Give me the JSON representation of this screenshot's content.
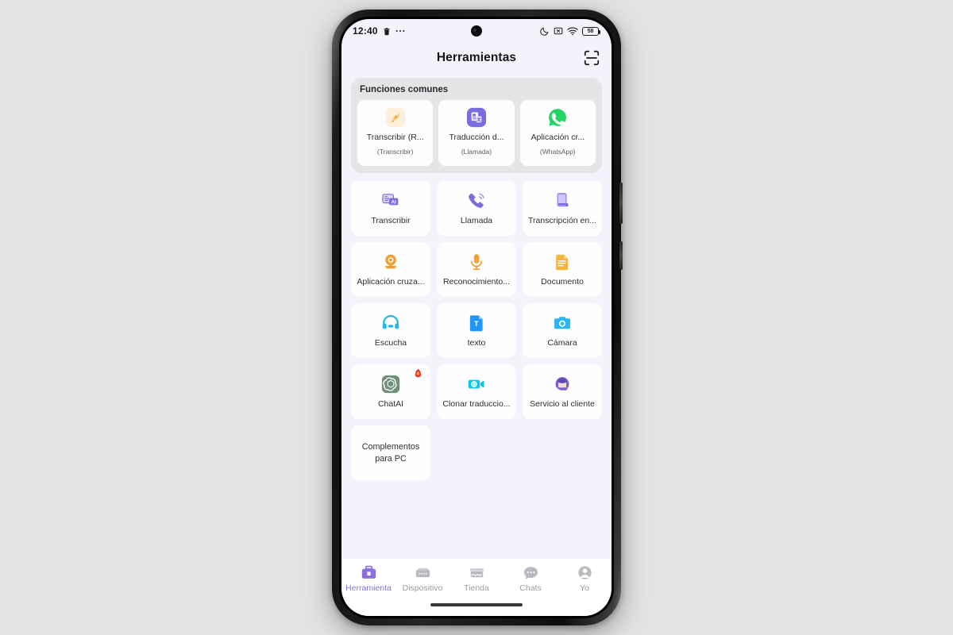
{
  "status_bar": {
    "time": "12:40",
    "left_icons": [
      "trash-icon",
      "more-dots-icon"
    ],
    "right_icons": [
      "moon-icon",
      "mute-icon",
      "wifi-icon"
    ],
    "battery_level": "58"
  },
  "header": {
    "title": "Herramientas",
    "scan_icon": "scan-icon"
  },
  "common_section": {
    "title": "Funciones comunes",
    "cards": [
      {
        "label": "Transcribir (R...",
        "sub": "(Transcribir)",
        "icon": "rocket-icon",
        "color": "#f5a623"
      },
      {
        "label": "Traducción d...",
        "sub": "(Llamada)",
        "icon": "translate-doc-icon",
        "color": "#7b6ce0"
      },
      {
        "label": "Aplicación cr...",
        "sub": "(WhatsApp)",
        "icon": "whatsapp-icon",
        "color": "#25d366"
      }
    ]
  },
  "tools": [
    {
      "label": "Transcribir",
      "icon": "ai-transcribe-icon",
      "color": "#7b6ce0",
      "badge": false
    },
    {
      "label": "Llamada",
      "icon": "phone-call-icon",
      "color": "#7b6ce0",
      "badge": false
    },
    {
      "label": "Transcripción en...",
      "icon": "phone-device-icon",
      "color": "#8d7ce8",
      "badge": false
    },
    {
      "label": "Aplicación cruza...",
      "icon": "webcam-icon",
      "color": "#f0a030",
      "badge": false
    },
    {
      "label": "Reconocimiento...",
      "icon": "microphone-icon",
      "color": "#f0a030",
      "badge": false
    },
    {
      "label": "Documento",
      "icon": "document-icon",
      "color": "#f5b43c",
      "badge": false
    },
    {
      "label": "Escucha",
      "icon": "headphones-icon",
      "color": "#22b8e0",
      "badge": false
    },
    {
      "label": "texto",
      "icon": "text-file-icon",
      "color": "#2196f3",
      "badge": false
    },
    {
      "label": "Cámara",
      "icon": "camera-icon",
      "color": "#29b6f6",
      "badge": false
    },
    {
      "label": "ChatAI",
      "icon": "openai-icon",
      "color": "#6f8f7a",
      "badge": true
    },
    {
      "label": "Clonar traduccio...",
      "icon": "video-translate-icon",
      "color": "#00c8f0",
      "badge": false
    },
    {
      "label": "Servicio al cliente",
      "icon": "support-agent-icon",
      "color": "#7b5fd0",
      "badge": false
    },
    {
      "label": "Complementos para PC",
      "icon": "",
      "color": "",
      "badge": false
    }
  ],
  "bottom_nav": [
    {
      "label": "Herramienta",
      "icon": "toolbox-icon",
      "active": true
    },
    {
      "label": "Dispositivo",
      "icon": "device-icon",
      "active": false
    },
    {
      "label": "Tienda",
      "icon": "store-icon",
      "active": false
    },
    {
      "label": "Chats",
      "icon": "chat-icon",
      "active": false
    },
    {
      "label": "Yo",
      "icon": "profile-icon",
      "active": false
    }
  ],
  "colors": {
    "accent": "#8a6fe0",
    "screen_bg": "#f4f3fc",
    "card_bg": "#fdfdfd",
    "panel_bg": "#e5e5e8"
  }
}
